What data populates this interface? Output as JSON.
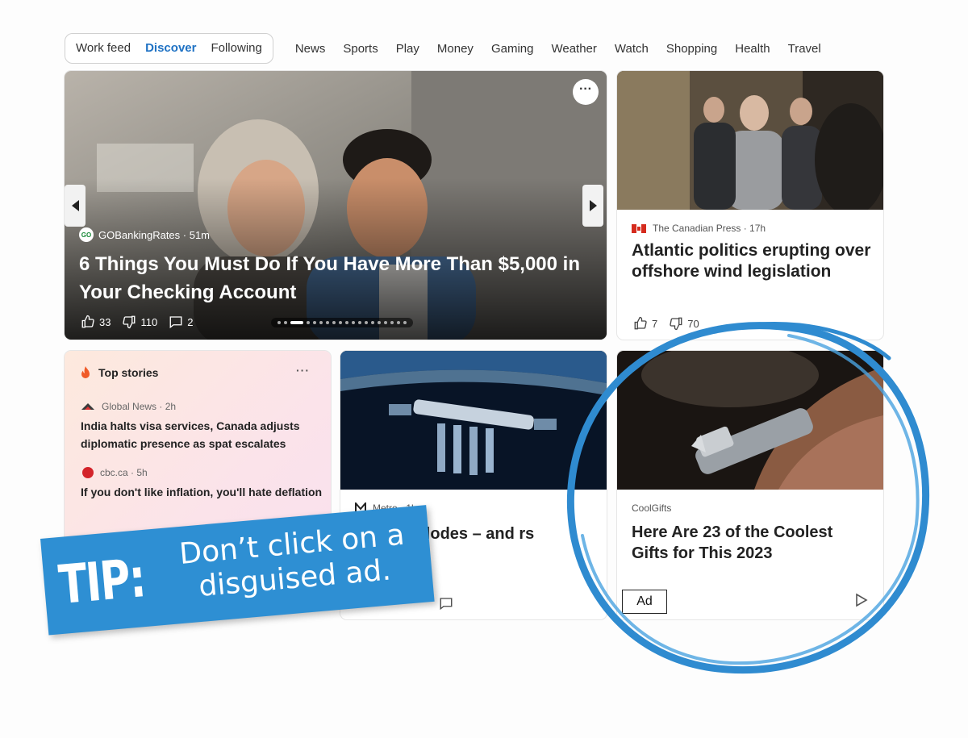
{
  "feed_tabs": [
    {
      "label": "Work feed",
      "active": false
    },
    {
      "label": "Discover",
      "active": true
    },
    {
      "label": "Following",
      "active": false
    }
  ],
  "nav_links": [
    "News",
    "Sports",
    "Play",
    "Money",
    "Gaming",
    "Weather",
    "Watch",
    "Shopping",
    "Health",
    "Travel"
  ],
  "hero": {
    "source": "GOBankingRates · 51m",
    "source_logo": "GO",
    "title": "6 Things You Must Do If You Have More Than $5,000 in Your Checking Account",
    "likes": "33",
    "dislikes": "110",
    "comments": "2",
    "more": "···",
    "carousel_dots": 19,
    "carousel_active": 2
  },
  "canadian_press": {
    "source": "The Canadian Press · 17h",
    "title": "Atlantic politics erupting over offshore wind legislation",
    "likes": "7",
    "dislikes": "70"
  },
  "top_stories": {
    "heading": "Top stories",
    "more": "···",
    "items": [
      {
        "source": "Global News · 2h",
        "title": "India halts visa services, Canada adjusts diplomatic presence as spat escalates"
      },
      {
        "source": "cbc.ca · 5h",
        "title": "If you don't like inflation, you'll hate deflation"
      }
    ]
  },
  "space_card": {
    "source": "Metro · 1h",
    "title": "ation explodes – and rs celebrate"
  },
  "ad_card": {
    "source": "CoolGifts",
    "title": "Here Are 23 of the Coolest Gifts for This 2023",
    "badge": "Ad"
  },
  "tip": {
    "label": "TIP:",
    "text": "Don’t click on a disguised ad."
  },
  "colors": {
    "accent": "#1f72c4",
    "tip_blue": "#2e8fd3",
    "ring_blue": "#2f8bd0"
  }
}
